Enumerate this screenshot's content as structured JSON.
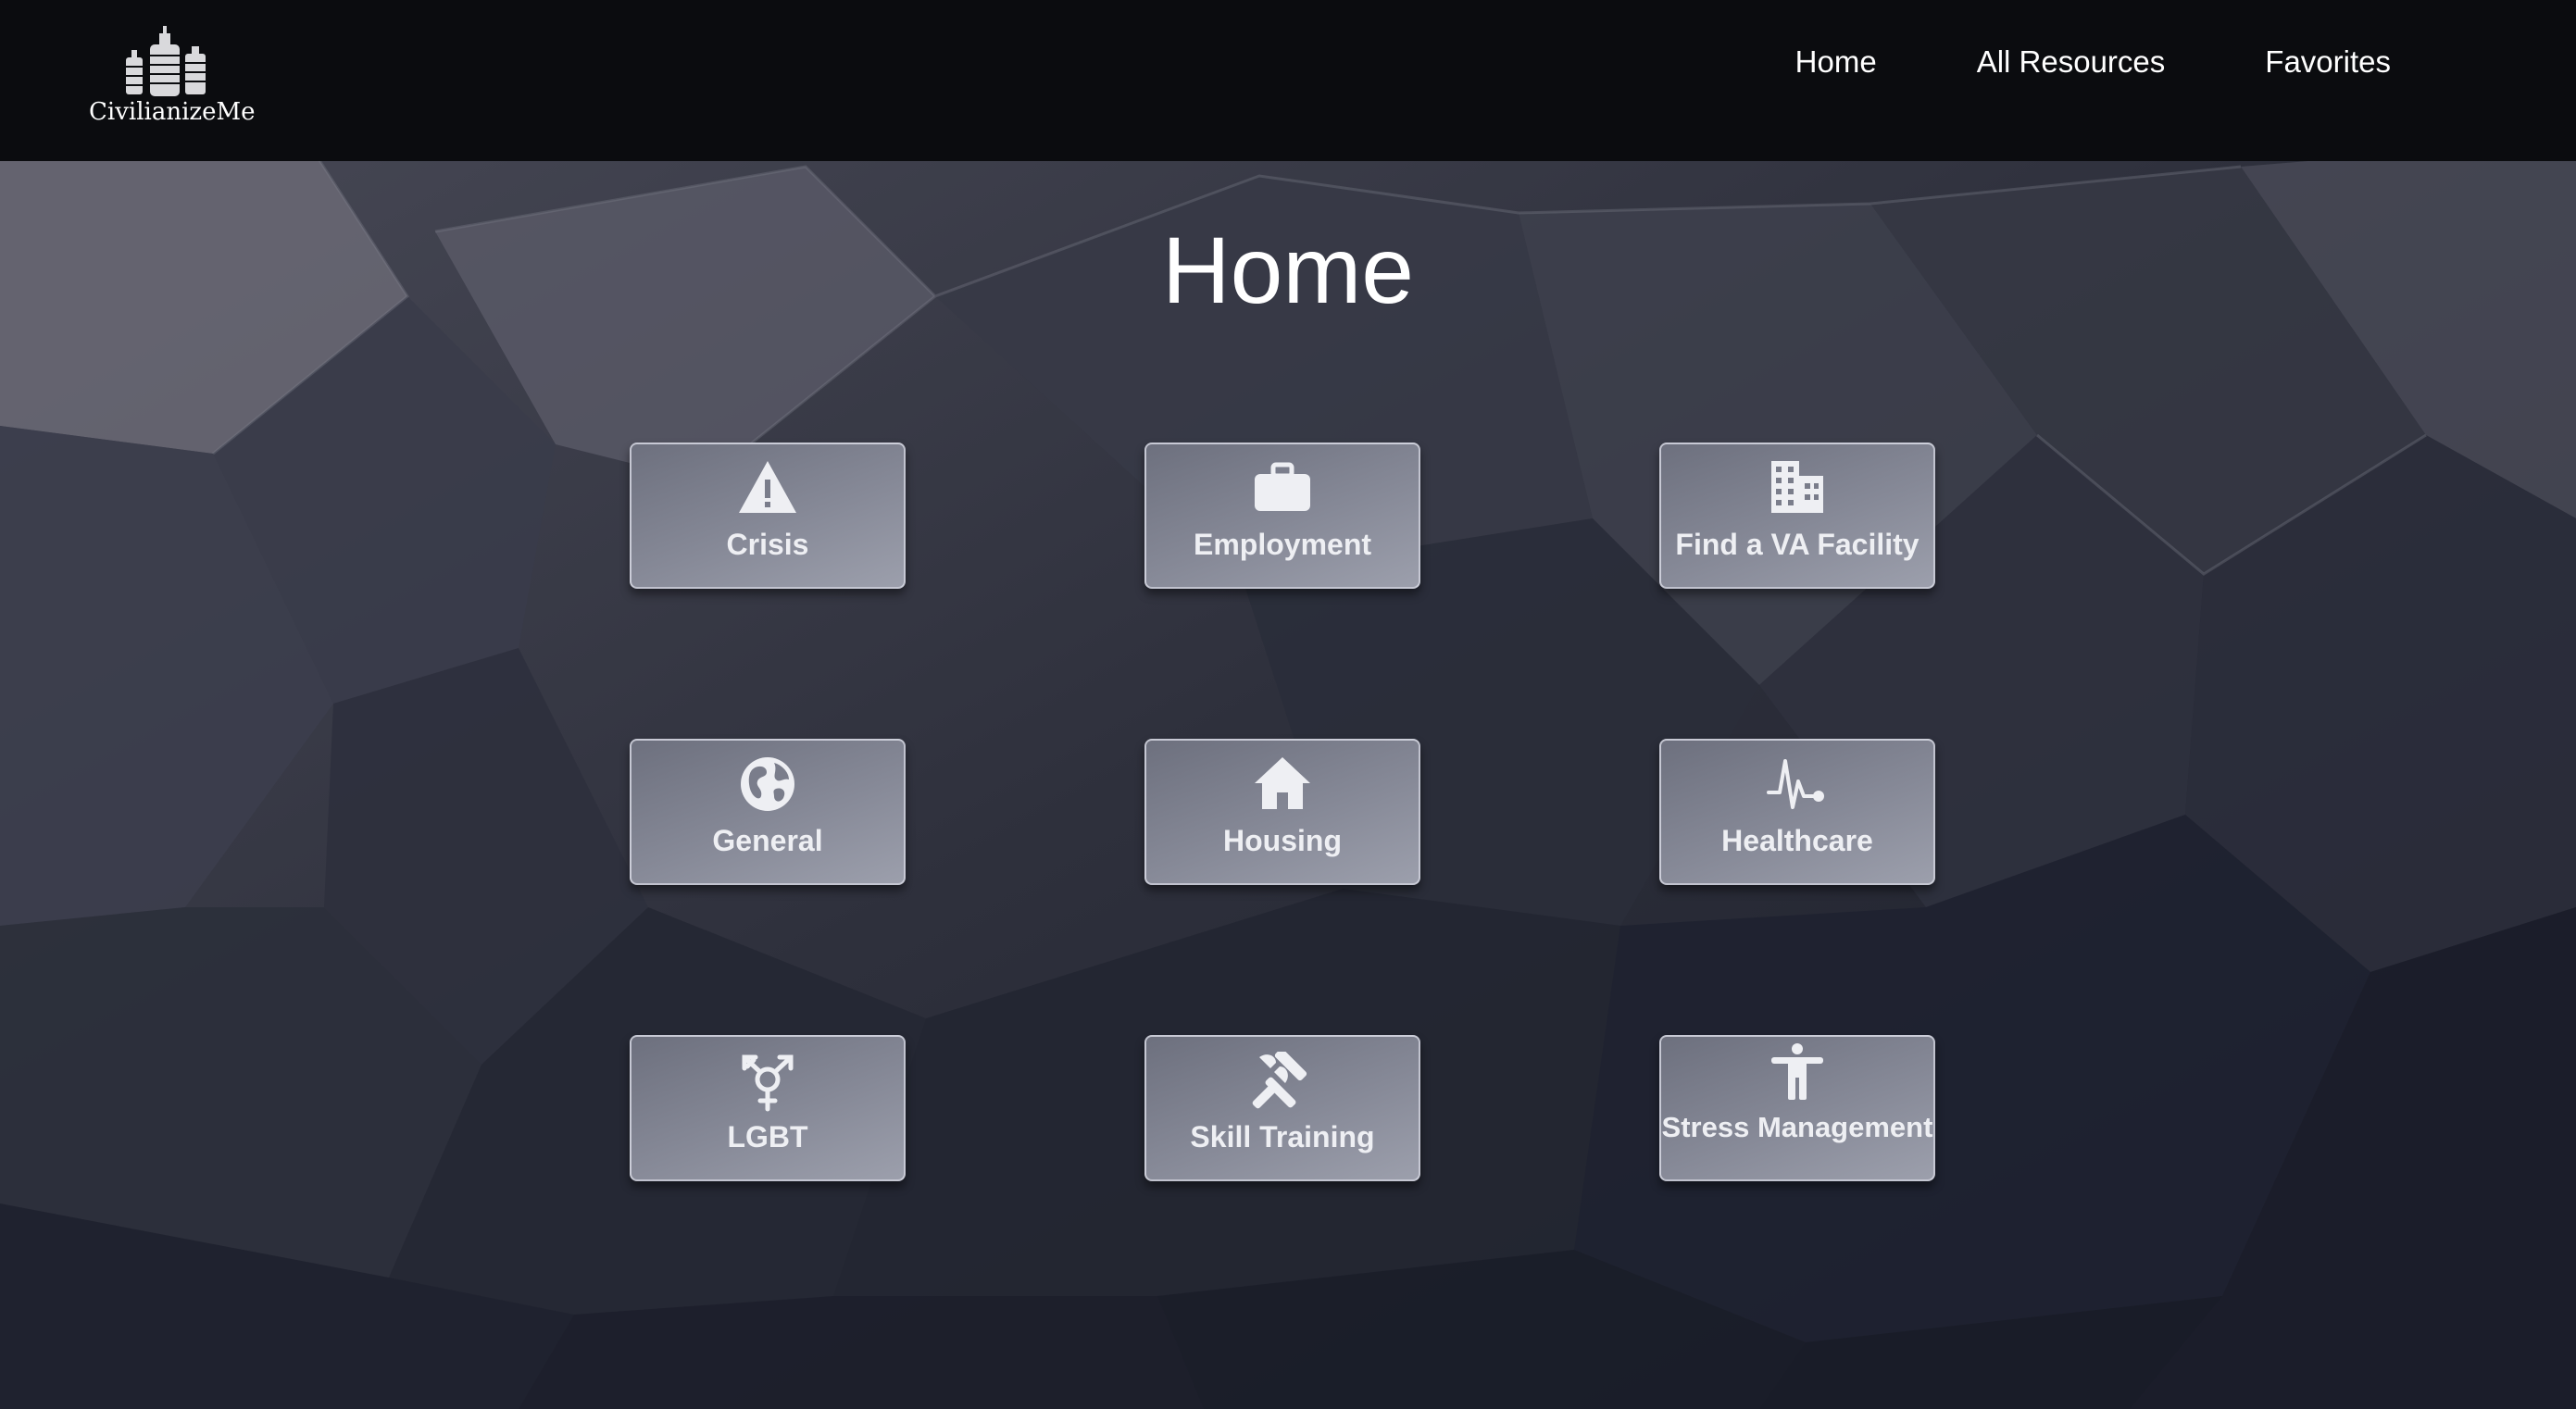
{
  "brand": {
    "name": "CivilianizeMe",
    "logo_icon": "city-skyline-icon"
  },
  "nav": {
    "items": [
      {
        "label": "Home"
      },
      {
        "label": "All Resources"
      },
      {
        "label": "Favorites"
      }
    ]
  },
  "page": {
    "title": "Home"
  },
  "tiles": [
    {
      "label": "Crisis",
      "icon": "warning-triangle-icon"
    },
    {
      "label": "Employment",
      "icon": "briefcase-icon"
    },
    {
      "label": "Find a VA Facility",
      "icon": "building-icon"
    },
    {
      "label": "General",
      "icon": "globe-icon"
    },
    {
      "label": "Housing",
      "icon": "house-icon"
    },
    {
      "label": "Healthcare",
      "icon": "heartbeat-icon"
    },
    {
      "label": "LGBT",
      "icon": "transgender-symbol-icon"
    },
    {
      "label": "Skill Training",
      "icon": "tools-icon"
    },
    {
      "label": "Stress Management",
      "icon": "standing-person-icon"
    }
  ],
  "colors": {
    "navbar": "#0b0c0f",
    "background": "#2b2e3b",
    "tile": "#868997",
    "text": "#ffffff"
  }
}
